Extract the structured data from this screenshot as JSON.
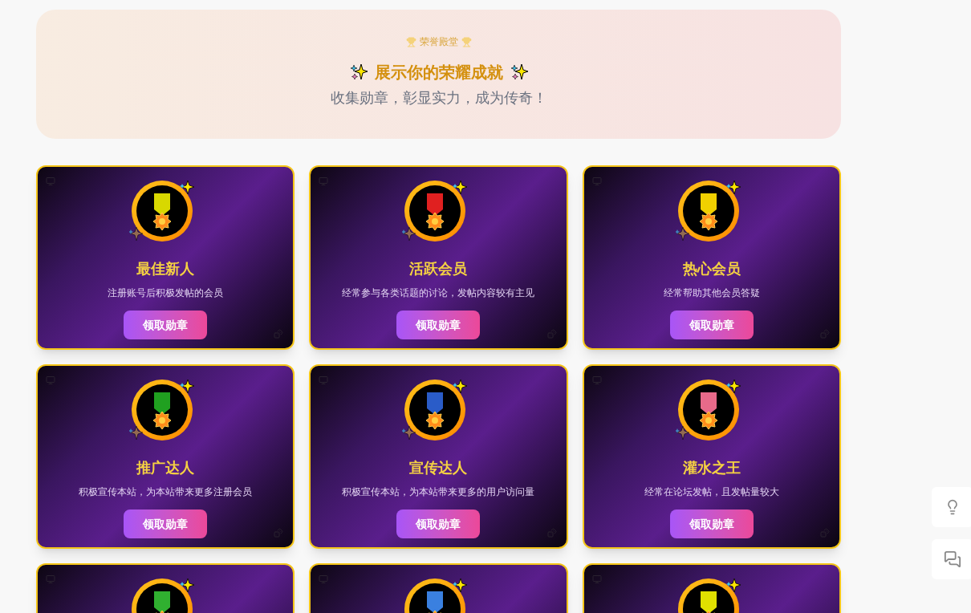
{
  "hero": {
    "eyebrow": "荣誉殿堂",
    "title": "展示你的荣耀成就",
    "subtitle": "收集勋章，彰显实力，成为传奇！"
  },
  "badges": [
    {
      "name": "最佳新人",
      "description": "注册账号后积极发帖的会员",
      "button": "领取勋章",
      "color": "#d8d800"
    },
    {
      "name": "活跃会员",
      "description": "经常参与各类话题的讨论，发帖内容较有主见",
      "button": "领取勋章",
      "color": "#e02020"
    },
    {
      "name": "热心会员",
      "description": "经常帮助其他会员答疑",
      "button": "领取勋章",
      "color": "#f0d000"
    },
    {
      "name": "推广达人",
      "description": "积极宣传本站，为本站带来更多注册会员",
      "button": "领取勋章",
      "color": "#20a020"
    },
    {
      "name": "宣传达人",
      "description": "积极宣传本站，为本站带来更多的用户访问量",
      "button": "领取勋章",
      "color": "#2a5cc8"
    },
    {
      "name": "灌水之王",
      "description": "经常在论坛发帖，且发帖量较大",
      "button": "领取勋章",
      "color": "#e86a8a"
    },
    {
      "color": "#30b030"
    },
    {
      "color": "#3a80e0"
    },
    {
      "color": "#e0e000"
    }
  ]
}
